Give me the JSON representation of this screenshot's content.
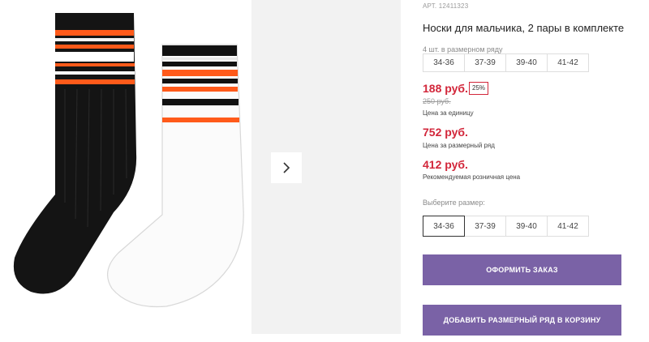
{
  "product": {
    "article_label": "АРТ. 12411323",
    "title": "Носки для мальчика, 2 пары в комплекте",
    "pack_note": "4 шт. в размерном ряду",
    "pack_sizes": [
      "34-36",
      "37-39",
      "39-40",
      "41-42"
    ],
    "unit_price": "188 руб.",
    "discount_badge": "25%",
    "old_price": "250 руб.",
    "unit_price_caption": "Цена за единицу",
    "row_price": "752 руб.",
    "row_price_caption": "Цена за размерный ряд",
    "retail_price": "412 руб.",
    "retail_price_caption": "Рекомендуемая розничная цена",
    "choose_size_label": "Выберите размер:",
    "size_options": [
      "34-36",
      "37-39",
      "39-40",
      "41-42"
    ],
    "selected_size": "34-36"
  },
  "actions": {
    "order_label": "ОФОРМИТЬ ЗАКАЗ",
    "add_row_label": "ДОБАВИТЬ РАЗМЕРНЫЙ РЯД В КОРЗИНУ"
  },
  "gallery": {
    "next_icon": "chevron-right-icon",
    "image": "black-and-white-striped-socks"
  },
  "colors": {
    "price": "#d2263a",
    "button": "#7a62a6",
    "stripe_orange": "#ff5a1a"
  }
}
